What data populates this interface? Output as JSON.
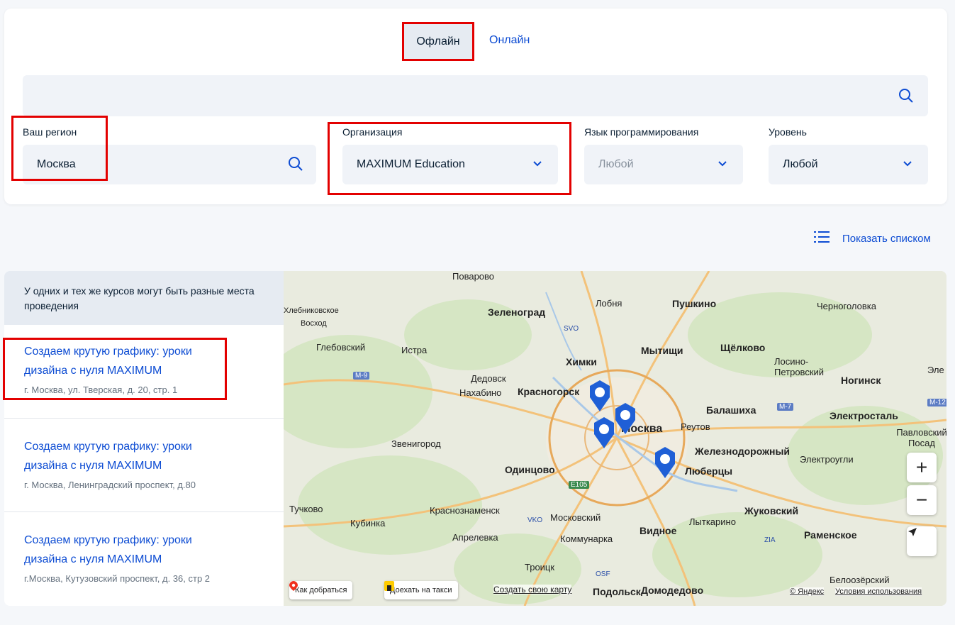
{
  "tabs": {
    "offline": "Офлайн",
    "online": "Онлайн"
  },
  "search": {
    "value": ""
  },
  "filters": {
    "region_label": "Ваш регион",
    "region_value": "Москва",
    "org_label": "Организация",
    "org_value": "MAXIMUM Education",
    "lang_label": "Язык программирования",
    "lang_value": "Любой",
    "level_label": "Уровень",
    "level_value": "Любой"
  },
  "show_list": "Показать списком",
  "notice": "У одних и тех же курсов могут быть разные места проведения",
  "courses": [
    {
      "title": "Создаем крутую графику: уроки дизайна с нуля MAXIMUM",
      "address": "г. Москва, ул. Тверская, д. 20, стр. 1"
    },
    {
      "title": "Создаем крутую графику: уроки дизайна с нуля MAXIMUM",
      "address": "г. Москва, Ленинградский проспект, д.80"
    },
    {
      "title": "Создаем крутую графику: уроки дизайна с нуля MAXIMUM",
      "address": "г.Москва, Кутузовский проспект, д. 36, стр 2"
    }
  ],
  "map": {
    "places": [
      "Поварово",
      "Лобня",
      "Пушкино",
      "Черноголовка",
      "Зеленоград",
      "Хлебниковское",
      "Восход",
      "Глебовский",
      "Истра",
      "Мытищи",
      "Щёлково",
      "Химки",
      "Лосино-Петровский",
      "Ногинск",
      "Электросталь",
      "Дедовск",
      "Нахабино",
      "Красногорск",
      "Балашиха",
      "Реутов",
      "Москва",
      "Звенигород",
      "Железнодорожный",
      "Электроугли",
      "Павловский Посад",
      "Одинцово",
      "Люберцы",
      "Тучково",
      "Кубинка",
      "Краснознаменск",
      "Московский",
      "Жуковский",
      "Лыткарино",
      "Апрелевка",
      "Коммунарка",
      "Видное",
      "Раменское",
      "Троицк",
      "Белоозёрский",
      "Подольск",
      "Домодедово",
      "Эле"
    ],
    "route_button": "Как добраться",
    "taxi_button": "Доехать на такси",
    "create_map": "Создать свою карту",
    "copyright": "© Яндекс",
    "terms": "Условия использования",
    "zoom_in": "+",
    "zoom_out": "−",
    "road_labels": [
      "M-9",
      "SVO",
      "M-7",
      "M-12",
      "E105",
      "VKO",
      "ZIA",
      "OSF"
    ]
  }
}
